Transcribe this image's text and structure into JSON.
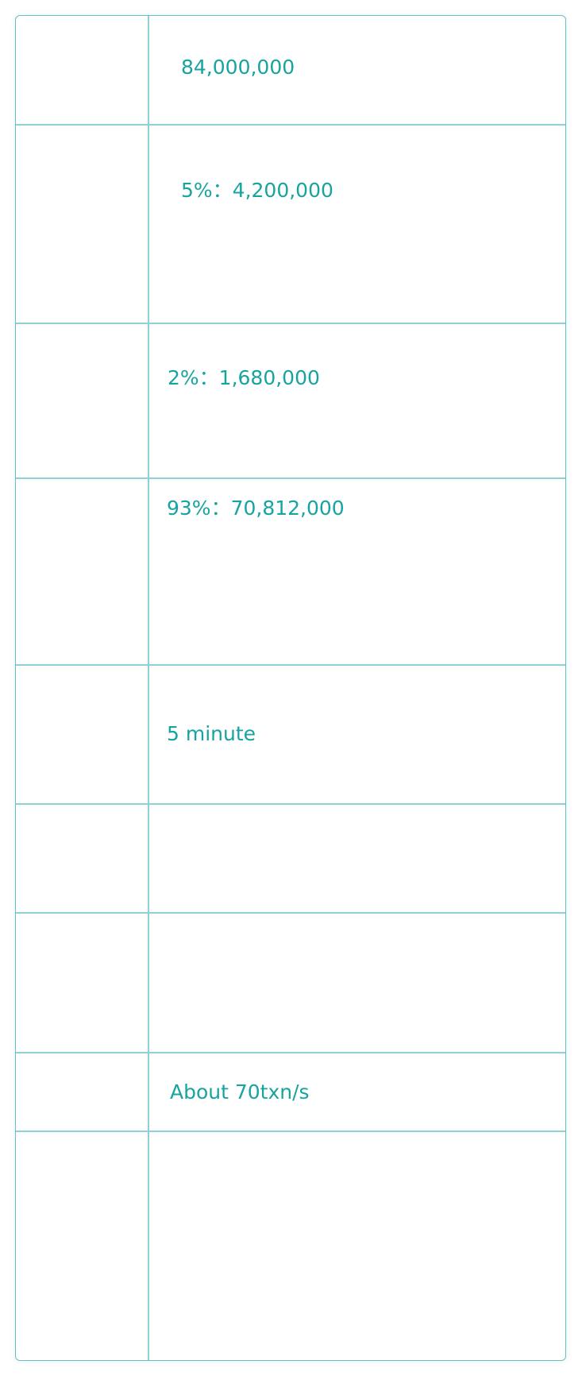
{
  "table": {
    "rows": [
      {
        "value": "84,000,000"
      },
      {
        "value": "5%：4,200,000"
      },
      {
        "value": "2%：1,680,000"
      },
      {
        "value": "93%：70,812,000"
      },
      {
        "value": "5 minute"
      },
      {
        "value": ""
      },
      {
        "value": ""
      },
      {
        "value": "About 70txn/s"
      },
      {
        "value": ""
      }
    ]
  }
}
